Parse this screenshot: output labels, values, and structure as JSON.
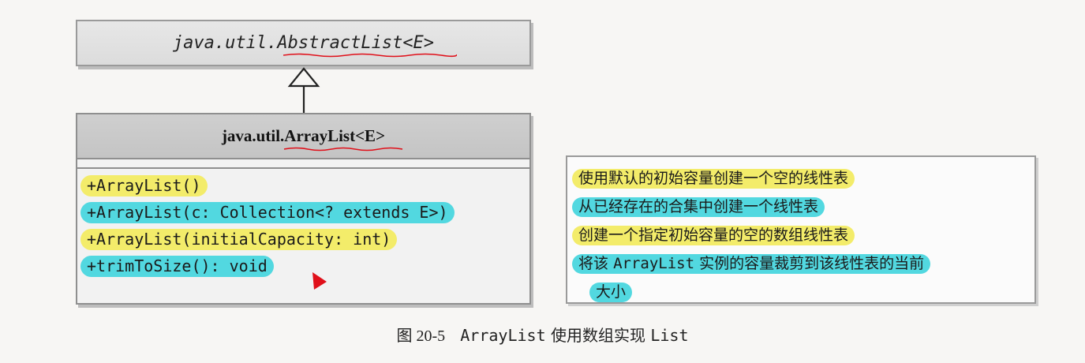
{
  "superclass": {
    "name": "java.util.AbstractList<E>"
  },
  "class": {
    "package": "java.util.",
    "name": "ArrayList<E>",
    "methods": [
      {
        "signature": "+ArrayList()",
        "highlight": "#f3ec6a"
      },
      {
        "signature": "+ArrayList(c: Collection<? extends E>)",
        "highlight": "#52d8e0"
      },
      {
        "signature": "+ArrayList(initialCapacity: int)",
        "highlight": "#f3ec6a"
      },
      {
        "signature": "+trimToSize(): void",
        "highlight": "#52d8e0"
      }
    ]
  },
  "descriptions": [
    "使用默认的初始容量创建一个空的线性表",
    "从已经存在的合集中创建一个线性表",
    "创建一个指定初始容量的空的数组线性表",
    {
      "before": "将该",
      "code": "ArrayList",
      "after": "实例的容量裁剪到该线性表的当前"
    },
    "大小"
  ],
  "caption": {
    "figure": "图 20-5",
    "code1": "ArrayList",
    "text": "使用数组实现",
    "code2": "List"
  },
  "colors": {
    "highlight_yellow": "#f3ec6a",
    "highlight_cyan": "#52d8e0",
    "annotation_red": "#e0101a"
  }
}
